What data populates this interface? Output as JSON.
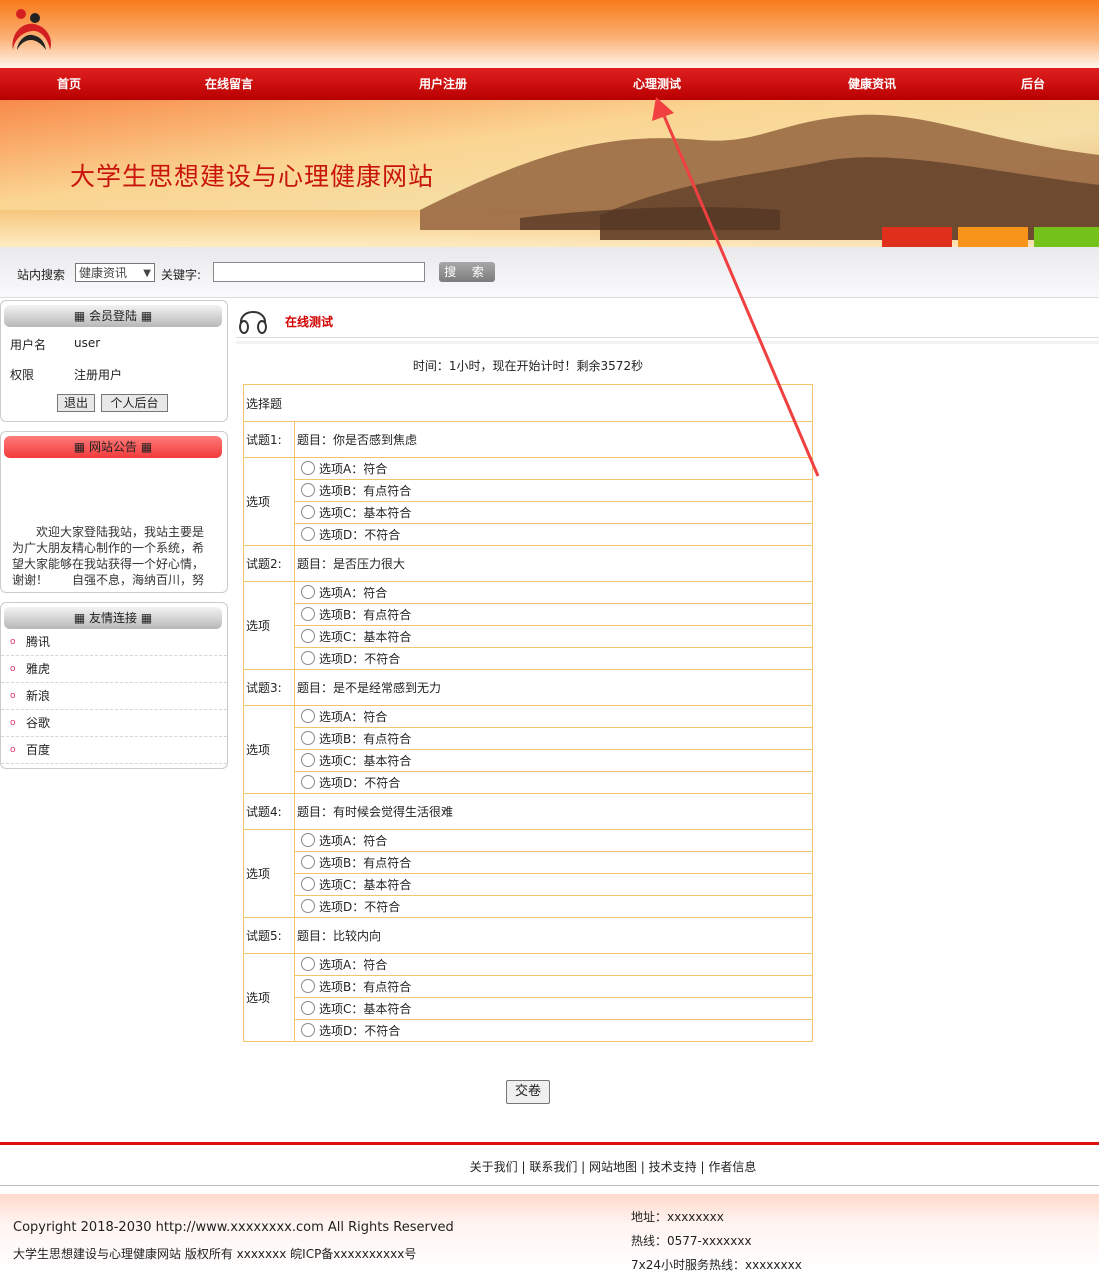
{
  "nav": [
    "首页",
    "在线留言",
    "用户注册",
    "心理测试",
    "健康资讯",
    "后台"
  ],
  "banner_title": "大学生思想建设与心理健康网站",
  "search": {
    "label": "站内搜索",
    "select_value": "健康资讯",
    "keyword_label": "关键字:",
    "keyword_value": "",
    "button": "搜 索"
  },
  "login_box": {
    "title": "会员登陆",
    "username_label": "用户名",
    "username": "user",
    "role_label": "权限",
    "role": "注册用户",
    "logout": "退出",
    "backend": "个人后台"
  },
  "notice_box": {
    "title": "网站公告",
    "text": "欢迎大家登陆我站，我站主要是为广大朋友精心制作的一个系统，希望大家能够在我站获得一个好心情，谢谢！　　自强不息，海纳百川，努力学"
  },
  "links_box": {
    "title": "友情连接",
    "items": [
      "腾讯",
      "雅虎",
      "新浪",
      "谷歌",
      "百度"
    ]
  },
  "test": {
    "caption": "在线测试",
    "timer": "时间：1小时，现在开始计时！剩余3572秒",
    "section": "选择题",
    "options_label": "选项",
    "questions": [
      {
        "num": "试题1:",
        "text": "题目：你是否感到焦虑"
      },
      {
        "num": "试题2:",
        "text": "题目：是否压力很大"
      },
      {
        "num": "试题3:",
        "text": "题目：是不是经常感到无力"
      },
      {
        "num": "试题4:",
        "text": "题目：有时候会觉得生活很难"
      },
      {
        "num": "试题5:",
        "text": "题目：比较内向"
      }
    ],
    "options": [
      "选项A：符合",
      "选项B：有点符合",
      "选项C：基本符合",
      "选项D：不符合"
    ],
    "submit": "交卷"
  },
  "footer": {
    "links": "关于我们 | 联系我们 | 网站地图 | 技术支持 | 作者信息",
    "copyright": "Copyright 2018-2030 http://www.xxxxxxxx.com All Rights Reserved",
    "icp": "大学生思想建设与心理健康网站 版权所有 xxxxxxx 皖ICP备xxxxxxxxxx号",
    "address": "地址：xxxxxxxx",
    "phone": "热线：0577-xxxxxxx",
    "hotline": "7x24小时服务热线：xxxxxxxx"
  }
}
